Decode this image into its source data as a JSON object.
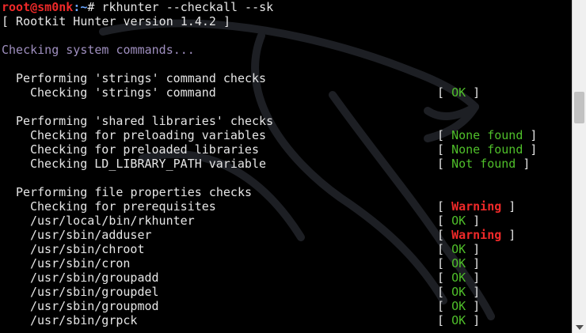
{
  "prompt": {
    "user_host": "root@sm0nk",
    "path": ":~",
    "symbol": "# ",
    "command": "rkhunter --checkall --sk"
  },
  "version_line": "[ Rootkit Hunter version 1.4.2 ]",
  "section_title": "Checking system commands...",
  "groups": [
    {
      "title": "Performing 'strings' command checks",
      "checks": [
        {
          "label": "Checking 'strings' command",
          "status": "OK",
          "kind": "ok"
        }
      ]
    },
    {
      "title": "Performing 'shared libraries' checks",
      "checks": [
        {
          "label": "Checking for preloading variables",
          "status": "None found",
          "kind": "ok"
        },
        {
          "label": "Checking for preloaded libraries",
          "status": "None found",
          "kind": "ok"
        },
        {
          "label": "Checking LD_LIBRARY_PATH variable",
          "status": "Not found",
          "kind": "ok"
        }
      ]
    },
    {
      "title": "Performing file properties checks",
      "checks": [
        {
          "label": "Checking for prerequisites",
          "status": "Warning",
          "kind": "warn"
        },
        {
          "label": "/usr/local/bin/rkhunter",
          "status": "OK",
          "kind": "ok"
        },
        {
          "label": "/usr/sbin/adduser",
          "status": "Warning",
          "kind": "warn"
        },
        {
          "label": "/usr/sbin/chroot",
          "status": "OK",
          "kind": "ok"
        },
        {
          "label": "/usr/sbin/cron",
          "status": "OK",
          "kind": "ok"
        },
        {
          "label": "/usr/sbin/groupadd",
          "status": "OK",
          "kind": "ok"
        },
        {
          "label": "/usr/sbin/groupdel",
          "status": "OK",
          "kind": "ok"
        },
        {
          "label": "/usr/sbin/groupmod",
          "status": "OK",
          "kind": "ok"
        },
        {
          "label": "/usr/sbin/grpck",
          "status": "OK",
          "kind": "ok"
        }
      ]
    }
  ],
  "colors": {
    "background": "#000000",
    "text": "#e6e6e6",
    "ok": "#4fbf2a",
    "warning": "#ef2929",
    "prompt_user": "#ef2929",
    "prompt_path": "#6aa6ff",
    "section": "#9f8fbf"
  },
  "scrollbar": {
    "position_fraction": 0.3
  },
  "icons": [
    "kali-dragon-watermark-icon",
    "scroll-down-arrow-icon"
  ]
}
